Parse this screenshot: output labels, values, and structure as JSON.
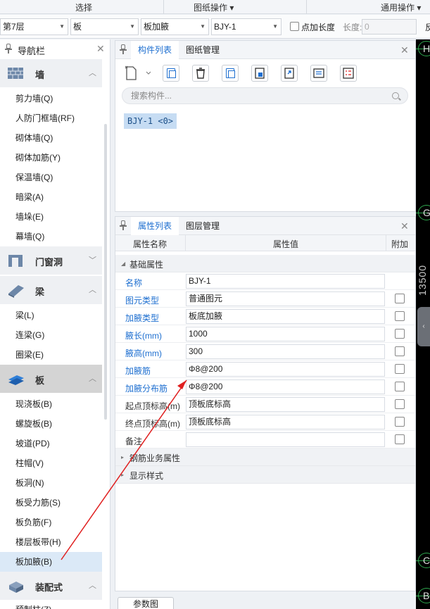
{
  "ribbon": {
    "group_select": "选择",
    "group_drawing": "图纸操作 ▾",
    "group_common": "通用操作 ▾"
  },
  "toolbar": {
    "floor": "第7层",
    "category": "板",
    "subtype": "板加腋",
    "component": "BJY-1",
    "point_length_label": "点加长度",
    "length_label": "长度:",
    "length_value": "0",
    "reverse_label": "反"
  },
  "nav": {
    "title": "导航栏",
    "categories": {
      "wall": "墙",
      "door_window": "门窗洞",
      "beam": "梁",
      "slab": "板",
      "prefab": "装配式"
    },
    "wall_items": [
      "剪力墙(Q)",
      "人防门框墙(RF)",
      "砌体墙(Q)",
      "砌体加筋(Y)",
      "保温墙(Q)",
      "暗梁(A)",
      "墙垛(E)",
      "幕墙(Q)"
    ],
    "beam_items": [
      "梁(L)",
      "连梁(G)",
      "圈梁(E)"
    ],
    "slab_items": [
      "现浇板(B)",
      "螺旋板(B)",
      "坡道(PD)",
      "柱帽(V)",
      "板洞(N)",
      "板受力筋(S)",
      "板负筋(F)",
      "楼层板带(H)",
      "板加腋(B)"
    ],
    "partial_item": "预制柱(Z)"
  },
  "component_panel": {
    "tab_list": "构件列表",
    "tab_drawing": "图纸管理",
    "search_placeholder": "搜索构件...",
    "selected_component": "BJY-1 <0>"
  },
  "property_panel": {
    "tab_props": "属性列表",
    "tab_layers": "图层管理",
    "col_name": "属性名称",
    "col_value": "属性值",
    "col_extra": "附加",
    "group_basic": "基础属性",
    "rows": [
      {
        "name": "名称",
        "value": "BJY-1"
      },
      {
        "name": "图元类型",
        "value": "普通图元"
      },
      {
        "name": "加腋类型",
        "value": "板底加腋"
      },
      {
        "name": "腋长(mm)",
        "value": "1000"
      },
      {
        "name": "腋高(mm)",
        "value": "300"
      },
      {
        "name": "加腋筋",
        "value": "Φ8@200"
      },
      {
        "name": "加腋分布筋",
        "value": "Φ8@200"
      },
      {
        "name": "起点顶标高(m)",
        "value": "顶板底标高"
      },
      {
        "name": "终点顶标高(m)",
        "value": "顶板底标高"
      },
      {
        "name": "备注",
        "value": ""
      }
    ],
    "group_rebar": "钢筋业务属性",
    "group_display": "显示样式"
  },
  "bottom": {
    "param_button": "参数图"
  },
  "canvas": {
    "axis_top": "H",
    "axis_mid": "G",
    "axis_c": "C",
    "axis_b": "B",
    "dimension": "13500",
    "collapse_glyph": "‹"
  },
  "colors": {
    "link_blue": "#1e6fd0",
    "annotation_red": "#e02020",
    "axis_green": "#2fa84f"
  }
}
